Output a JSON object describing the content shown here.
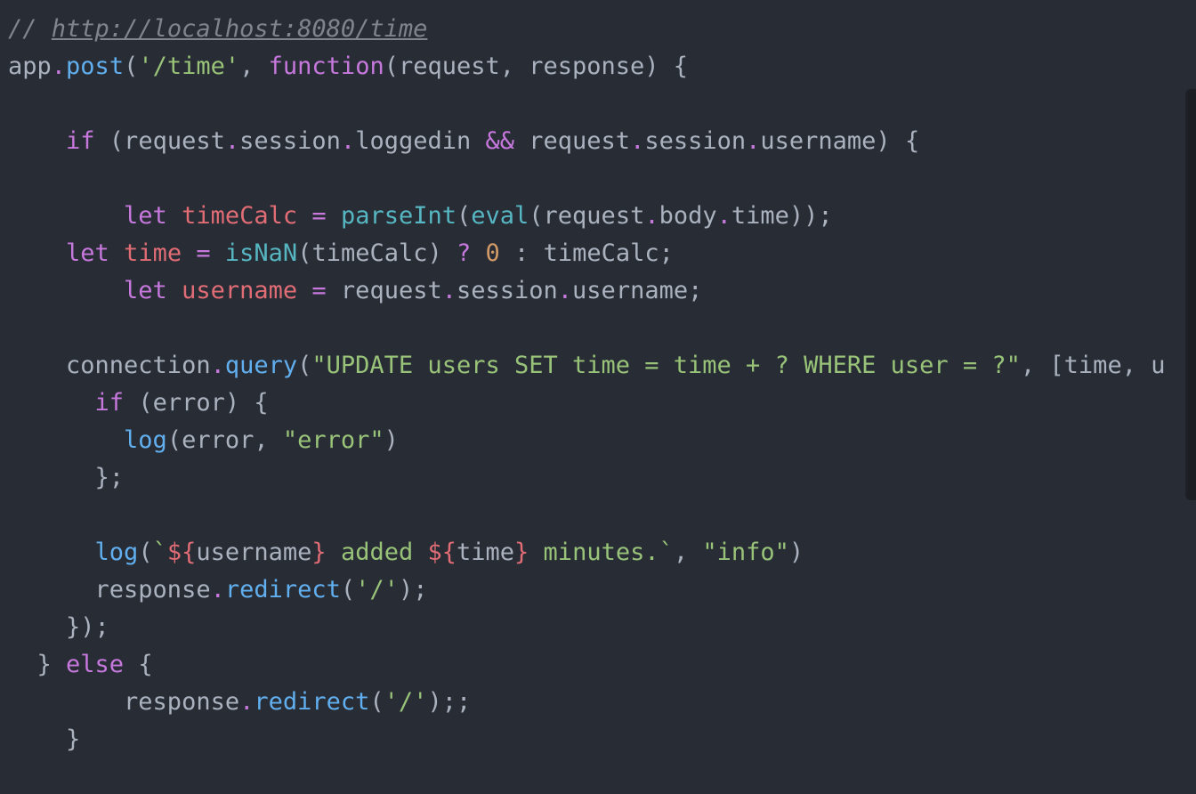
{
  "editor": {
    "theme_colors": {
      "background": "#282c34",
      "plain": "#abb2bf",
      "comment": "#7f848e",
      "keyword": "#c678dd",
      "function": "#61afef",
      "builtin": "#56b6c2",
      "variable": "#e06c75",
      "string": "#98c379",
      "number": "#d19a66"
    },
    "lines": [
      [
        {
          "t": "comment",
          "v": "// "
        },
        {
          "t": "comment-link",
          "v": "http://localhost:8080/time"
        }
      ],
      [
        {
          "t": "plain",
          "v": "app"
        },
        {
          "t": "punct",
          "v": "."
        },
        {
          "t": "function",
          "v": "post"
        },
        {
          "t": "plain",
          "v": "("
        },
        {
          "t": "string",
          "v": "'/time'"
        },
        {
          "t": "plain",
          "v": ", "
        },
        {
          "t": "keyword",
          "v": "function"
        },
        {
          "t": "plain",
          "v": "(request, response) {"
        }
      ],
      [],
      [
        {
          "t": "plain",
          "v": "    "
        },
        {
          "t": "keyword",
          "v": "if"
        },
        {
          "t": "plain",
          "v": " (request"
        },
        {
          "t": "punct",
          "v": "."
        },
        {
          "t": "plain",
          "v": "session"
        },
        {
          "t": "punct",
          "v": "."
        },
        {
          "t": "plain",
          "v": "loggedin "
        },
        {
          "t": "keyword",
          "v": "&&"
        },
        {
          "t": "plain",
          "v": " request"
        },
        {
          "t": "punct",
          "v": "."
        },
        {
          "t": "plain",
          "v": "session"
        },
        {
          "t": "punct",
          "v": "."
        },
        {
          "t": "plain",
          "v": "username) {"
        }
      ],
      [],
      [
        {
          "t": "plain",
          "v": "        "
        },
        {
          "t": "keyword",
          "v": "let"
        },
        {
          "t": "plain",
          "v": " "
        },
        {
          "t": "variable",
          "v": "timeCalc"
        },
        {
          "t": "plain",
          "v": " "
        },
        {
          "t": "keyword",
          "v": "="
        },
        {
          "t": "plain",
          "v": " "
        },
        {
          "t": "builtin",
          "v": "parseInt"
        },
        {
          "t": "plain",
          "v": "("
        },
        {
          "t": "builtin",
          "v": "eval"
        },
        {
          "t": "plain",
          "v": "(request"
        },
        {
          "t": "punct",
          "v": "."
        },
        {
          "t": "plain",
          "v": "body"
        },
        {
          "t": "punct",
          "v": "."
        },
        {
          "t": "plain",
          "v": "time));"
        }
      ],
      [
        {
          "t": "plain",
          "v": "    "
        },
        {
          "t": "keyword",
          "v": "let"
        },
        {
          "t": "plain",
          "v": " "
        },
        {
          "t": "variable",
          "v": "time"
        },
        {
          "t": "plain",
          "v": " "
        },
        {
          "t": "keyword",
          "v": "="
        },
        {
          "t": "plain",
          "v": " "
        },
        {
          "t": "builtin",
          "v": "isNaN"
        },
        {
          "t": "plain",
          "v": "(timeCalc) "
        },
        {
          "t": "keyword",
          "v": "?"
        },
        {
          "t": "plain",
          "v": " "
        },
        {
          "t": "number",
          "v": "0"
        },
        {
          "t": "plain",
          "v": " : timeCalc;"
        }
      ],
      [
        {
          "t": "plain",
          "v": "        "
        },
        {
          "t": "keyword",
          "v": "let"
        },
        {
          "t": "plain",
          "v": " "
        },
        {
          "t": "variable",
          "v": "username"
        },
        {
          "t": "plain",
          "v": " "
        },
        {
          "t": "keyword",
          "v": "="
        },
        {
          "t": "plain",
          "v": " request"
        },
        {
          "t": "punct",
          "v": "."
        },
        {
          "t": "plain",
          "v": "session"
        },
        {
          "t": "punct",
          "v": "."
        },
        {
          "t": "plain",
          "v": "username;"
        }
      ],
      [],
      [
        {
          "t": "plain",
          "v": "    connection"
        },
        {
          "t": "punct",
          "v": "."
        },
        {
          "t": "function",
          "v": "query"
        },
        {
          "t": "plain",
          "v": "("
        },
        {
          "t": "string",
          "v": "\"UPDATE users SET time = time + ? WHERE user = ?\""
        },
        {
          "t": "plain",
          "v": ", [time, u"
        }
      ],
      [
        {
          "t": "plain",
          "v": "      "
        },
        {
          "t": "keyword",
          "v": "if"
        },
        {
          "t": "plain",
          "v": " (error) {"
        }
      ],
      [
        {
          "t": "plain",
          "v": "        "
        },
        {
          "t": "function",
          "v": "log"
        },
        {
          "t": "plain",
          "v": "(error, "
        },
        {
          "t": "string",
          "v": "\"error\""
        },
        {
          "t": "plain",
          "v": ")"
        }
      ],
      [
        {
          "t": "plain",
          "v": "      };"
        }
      ],
      [],
      [
        {
          "t": "plain",
          "v": "      "
        },
        {
          "t": "function",
          "v": "log"
        },
        {
          "t": "plain",
          "v": "("
        },
        {
          "t": "string",
          "v": "`"
        },
        {
          "t": "interp",
          "v": "${"
        },
        {
          "t": "plain",
          "v": "username"
        },
        {
          "t": "interp",
          "v": "}"
        },
        {
          "t": "string",
          "v": " added "
        },
        {
          "t": "interp",
          "v": "${"
        },
        {
          "t": "plain",
          "v": "time"
        },
        {
          "t": "interp",
          "v": "}"
        },
        {
          "t": "string",
          "v": " minutes.`"
        },
        {
          "t": "plain",
          "v": ", "
        },
        {
          "t": "string",
          "v": "\"info\""
        },
        {
          "t": "plain",
          "v": ")"
        }
      ],
      [
        {
          "t": "plain",
          "v": "      response"
        },
        {
          "t": "punct",
          "v": "."
        },
        {
          "t": "function",
          "v": "redirect"
        },
        {
          "t": "plain",
          "v": "("
        },
        {
          "t": "string",
          "v": "'/'"
        },
        {
          "t": "plain",
          "v": ");"
        }
      ],
      [
        {
          "t": "plain",
          "v": "    });"
        }
      ],
      [
        {
          "t": "plain",
          "v": "  } "
        },
        {
          "t": "keyword",
          "v": "else"
        },
        {
          "t": "plain",
          "v": " {"
        }
      ],
      [
        {
          "t": "plain",
          "v": "        response"
        },
        {
          "t": "punct",
          "v": "."
        },
        {
          "t": "function",
          "v": "redirect"
        },
        {
          "t": "plain",
          "v": "("
        },
        {
          "t": "string",
          "v": "'/'"
        },
        {
          "t": "plain",
          "v": ");;"
        }
      ],
      [
        {
          "t": "plain",
          "v": "    }"
        }
      ]
    ]
  }
}
